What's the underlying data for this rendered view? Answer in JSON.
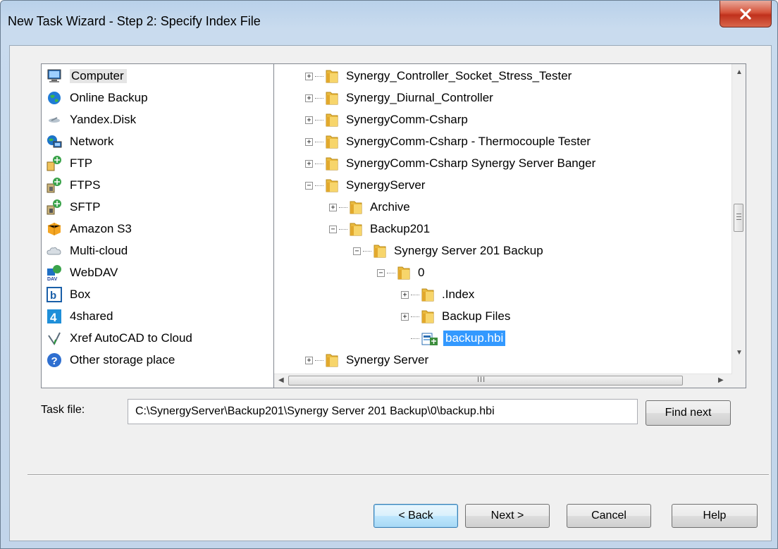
{
  "window": {
    "title": "New Task Wizard - Step 2: Specify Index File"
  },
  "storage_list": [
    {
      "label": "Computer",
      "icon": "computer-icon"
    },
    {
      "label": "Online Backup",
      "icon": "globe-icon"
    },
    {
      "label": "Yandex.Disk",
      "icon": "yandex-disk-icon"
    },
    {
      "label": "Network",
      "icon": "network-icon"
    },
    {
      "label": "FTP",
      "icon": "ftp-icon"
    },
    {
      "label": "FTPS",
      "icon": "ftps-icon"
    },
    {
      "label": "SFTP",
      "icon": "sftp-icon"
    },
    {
      "label": "Amazon S3",
      "icon": "amazon-s3-icon"
    },
    {
      "label": "Multi-cloud",
      "icon": "multi-cloud-icon"
    },
    {
      "label": "WebDAV",
      "icon": "webdav-icon"
    },
    {
      "label": "Box",
      "icon": "box-icon"
    },
    {
      "label": "4shared",
      "icon": "4shared-icon"
    },
    {
      "label": "Xref AutoCAD to Cloud",
      "icon": "xref-icon"
    },
    {
      "label": "Other storage place",
      "icon": "question-icon"
    }
  ],
  "tree": [
    {
      "label": "Synergy_Controller_Socket_Stress_Tester",
      "level": 0,
      "expander": "+"
    },
    {
      "label": "Synergy_Diurnal_Controller",
      "level": 0,
      "expander": "+"
    },
    {
      "label": "SynergyComm-Csharp",
      "level": 0,
      "expander": "+"
    },
    {
      "label": "SynergyComm-Csharp - Thermocouple Tester",
      "level": 0,
      "expander": "+"
    },
    {
      "label": "SynergyComm-Csharp Synergy Server Banger",
      "level": 0,
      "expander": "+"
    },
    {
      "label": "SynergyServer",
      "level": 0,
      "expander": "-"
    },
    {
      "label": "Archive",
      "level": 1,
      "expander": "+"
    },
    {
      "label": "Backup201",
      "level": 1,
      "expander": "-"
    },
    {
      "label": "Synergy Server 201 Backup",
      "level": 2,
      "expander": "-"
    },
    {
      "label": "0",
      "level": 3,
      "expander": "-"
    },
    {
      "label": ".Index",
      "level": 4,
      "expander": "+"
    },
    {
      "label": "Backup Files",
      "level": 4,
      "expander": "+"
    },
    {
      "label": "backup.hbi",
      "level": 4,
      "expander": "",
      "file": true,
      "selected": true
    },
    {
      "label": "Synergy Server",
      "level": 0,
      "expander": "+"
    }
  ],
  "scroll": {
    "h_grip": "III"
  },
  "task_file": {
    "label": "Task file:",
    "value": "C:\\SynergyServer\\Backup201\\Synergy Server 201 Backup\\0\\backup.hbi"
  },
  "buttons": {
    "find_next": "Find next",
    "back": "< Back",
    "next": "Next >",
    "cancel": "Cancel",
    "help": "Help"
  },
  "colors": {
    "selection": "#3399ff",
    "folder": "#f1c24d",
    "close": "#c7432b"
  }
}
